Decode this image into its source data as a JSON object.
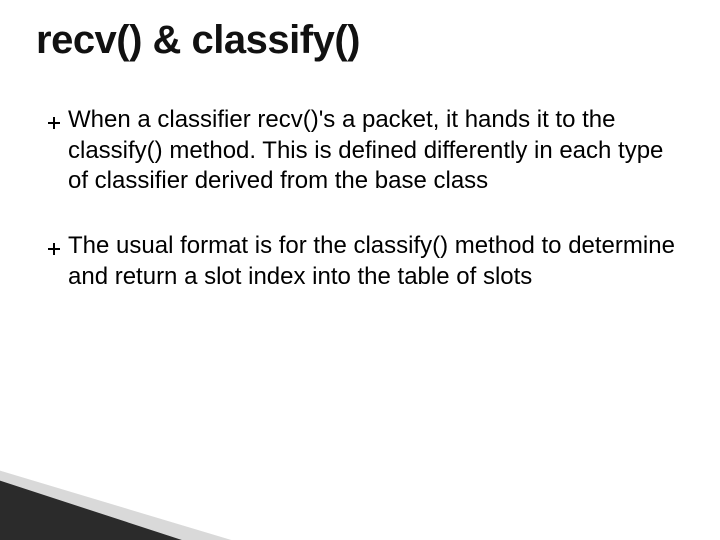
{
  "title": "recv() & classify()",
  "bullets": [
    "When a classifier recv()'s a packet, it hands it to the classify() method. This is defined differently in each type of classifier derived from the base class",
    "The usual format is for the classify() method to determine and return a slot index into the table of slots"
  ]
}
